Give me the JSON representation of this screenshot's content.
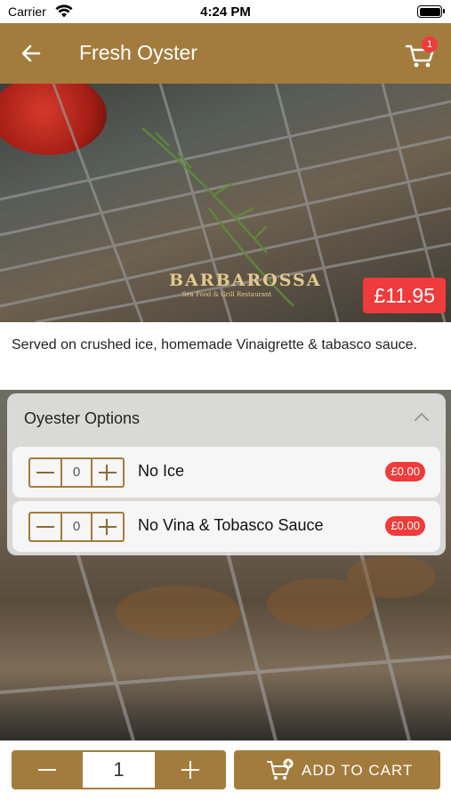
{
  "status_bar": {
    "carrier": "Carrier",
    "time": "4:24 PM",
    "icons": [
      "wifi-icon",
      "battery-icon"
    ]
  },
  "nav": {
    "title": "Fresh Oyster",
    "back_icon": "arrow-left-icon",
    "cart_icon": "cart-icon",
    "cart_count": "1"
  },
  "hero": {
    "logo_name": "BARBAROSSA",
    "logo_subtitle": "Sea Food & Grill Restaurant",
    "price": "£11.95"
  },
  "description": "Served on crushed ice, homemade Vinaigrette & tabasco sauce.",
  "options": {
    "title": "Oyester Options",
    "collapse_icon": "chevron-up-icon",
    "items": [
      {
        "label": "No Ice",
        "quantity": "0",
        "price": "£0.00"
      },
      {
        "label": "No Vina & Tobasco Sauce",
        "quantity": "0",
        "price": "£0.00"
      }
    ]
  },
  "bottom": {
    "quantity": "1",
    "add_to_cart_label": "ADD TO CART",
    "add_to_cart_icon": "cart-plus-icon"
  },
  "colors": {
    "brand": "#a37c3d",
    "accent_red": "#ef3b3b",
    "text": "#222222"
  }
}
